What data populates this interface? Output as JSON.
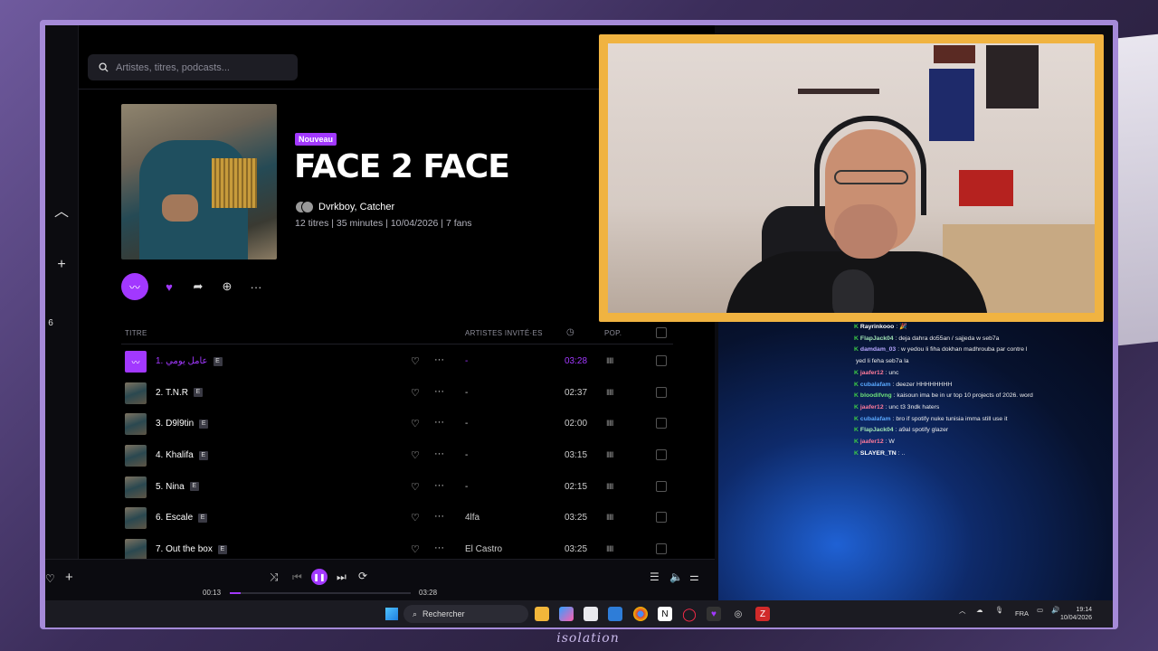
{
  "app": {
    "search_placeholder": "Artistes, titres, podcasts...",
    "album": {
      "badge": "Nouveau",
      "title": "FACE 2 FACE",
      "artists": "Dvrkboy, Catcher",
      "meta": "12 titres | 35 minutes | 10/04/2026 | 7 fans"
    },
    "rail": {
      "collapse_icon": "chevron-up-icon",
      "add_icon": "plus-icon",
      "side_number": "6"
    },
    "table_headers": {
      "title": "TITRE",
      "featured": "ARTISTES INVITÉ·ES",
      "pop": "POP."
    },
    "tracks": [
      {
        "title": "1. عامل يومي",
        "explicit": "E",
        "featured": "-",
        "duration": "03:28",
        "pop": "IIIII",
        "active": true
      },
      {
        "title": "2. T.N.R",
        "explicit": "E",
        "featured": "-",
        "duration": "02:37",
        "pop": "IIIII",
        "active": false
      },
      {
        "title": "3. D9l9tin",
        "explicit": "E",
        "featured": "-",
        "duration": "02:00",
        "pop": "IIIII",
        "active": false
      },
      {
        "title": "4. Khalifa",
        "explicit": "E",
        "featured": "-",
        "duration": "03:15",
        "pop": "IIIII",
        "active": false
      },
      {
        "title": "5. Nina",
        "explicit": "E",
        "featured": "-",
        "duration": "02:15",
        "pop": "IIIII",
        "active": false
      },
      {
        "title": "6. Escale",
        "explicit": "E",
        "featured": "4lfa",
        "duration": "03:25",
        "pop": "IIIII",
        "active": false
      },
      {
        "title": "7. Out the box",
        "explicit": "E",
        "featured": "El Castro",
        "duration": "03:25",
        "pop": "IIIII",
        "active": false
      }
    ],
    "player": {
      "elapsed": "00:13",
      "total": "03:28",
      "progress": 0.06
    }
  },
  "chat": [
    {
      "user": "Rayrinkooo",
      "text": " : 🎉",
      "color": "#ffffff"
    },
    {
      "user": "FlapJack04",
      "text": " : deja dahra do55an / sajjeda w seb7a",
      "color": "#9fe3b4"
    },
    {
      "user": "damdam_03",
      "text": " : w yedou li fiha dokhan madhrouba par contre l",
      "color": "#b7a6ff"
    },
    {
      "user": "",
      "text": "yed li feha seb7a la",
      "color": "#ffffff"
    },
    {
      "user": "jaafer12",
      "text": " : unc",
      "color": "#ff7a9a"
    },
    {
      "user": "cubalafam",
      "text": " : deezer HHHHHHHH",
      "color": "#5aa9ff"
    },
    {
      "user": "bloodifvng",
      "text": " : kaisoun ima be in ur top 10 projects of 2026. word",
      "color": "#6fe37a"
    },
    {
      "user": "jaafer12",
      "text": " : unc t3 3ndk haters",
      "color": "#ff7a9a"
    },
    {
      "user": "cubalafam",
      "text": " : bro if spotify nuke tunisia imma still use it",
      "color": "#5aa9ff"
    },
    {
      "user": "FlapJack04",
      "text": " : a9al spotify glazer",
      "color": "#9fe3b4"
    },
    {
      "user": "jaafer12",
      "text": " : W",
      "color": "#ff7a9a"
    },
    {
      "user": "SLAYER_TN",
      "text": " : ..",
      "color": "#ffffff"
    }
  ],
  "taskbar": {
    "search_label": "Rechercher",
    "lang": "FRA",
    "time": "19:14",
    "date": "10/04/2026"
  },
  "overlay": {
    "brand": "isolation"
  },
  "colors": {
    "accent": "#a238ff",
    "frame": "#a58ad8",
    "cam_border": "#f0b341"
  }
}
